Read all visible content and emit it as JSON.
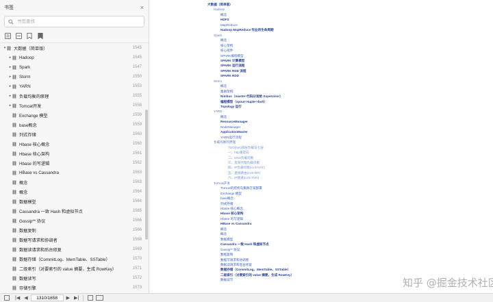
{
  "sidebar": {
    "title": "书签",
    "close_icon": "×",
    "search_placeholder": "书签查找",
    "tools": [
      "expand-all-icon",
      "collapse-all-icon",
      "add-bookmark-icon",
      "bookmark-options-icon"
    ],
    "items": [
      {
        "label": "大数据（简单版）",
        "page": "1545",
        "indent": 0,
        "arrow": "▾"
      },
      {
        "label": "Hadoop",
        "page": "1545",
        "indent": 1,
        "arrow": "▸"
      },
      {
        "label": "Spark",
        "page": "1547",
        "indent": 1,
        "arrow": "▸"
      },
      {
        "label": "Storm",
        "page": "1550",
        "indent": 1,
        "arrow": "▸"
      },
      {
        "label": "YARN",
        "page": "1553",
        "indent": 1,
        "arrow": "▸"
      },
      {
        "label": "负载均衡的原理",
        "page": "1555",
        "indent": 1,
        "arrow": "▸"
      },
      {
        "label": "Tomcat开发",
        "page": "1558",
        "indent": 1,
        "arrow": "▸"
      },
      {
        "label": "Exchange 模型",
        "page": "1559",
        "indent": 1,
        "arrow": ""
      },
      {
        "label": "base概念",
        "page": "1559",
        "indent": 1,
        "arrow": ""
      },
      {
        "label": "列式存储",
        "page": "1560",
        "indent": 1,
        "arrow": ""
      },
      {
        "label": "Hbase 核心概念",
        "page": "1560",
        "indent": 1,
        "arrow": ""
      },
      {
        "label": "Hbase 核心架构",
        "page": "1561",
        "indent": 1,
        "arrow": ""
      },
      {
        "label": "Hbase 的写逻辑",
        "page": "1562",
        "indent": 1,
        "arrow": ""
      },
      {
        "label": "HBase vs Cassandra",
        "page": "1563",
        "indent": 1,
        "arrow": ""
      },
      {
        "label": "概念",
        "page": "1563",
        "indent": 1,
        "arrow": ""
      },
      {
        "label": "概念",
        "page": "1564",
        "indent": 1,
        "arrow": ""
      },
      {
        "label": "数据模型",
        "page": "1564",
        "indent": 1,
        "arrow": ""
      },
      {
        "label": "Cassandra 一致 Hash 和虚拟节点",
        "page": "1565",
        "indent": 1,
        "arrow": ""
      },
      {
        "label": "Gossip** 协议",
        "page": "1566",
        "indent": 1,
        "arrow": ""
      },
      {
        "label": "数据复制",
        "page": "1566",
        "indent": 1,
        "arrow": ""
      },
      {
        "label": "数据写请求和协调者",
        "page": "1568",
        "indent": 1,
        "arrow": ""
      },
      {
        "label": "数据读请求和后台修复",
        "page": "1569",
        "indent": 1,
        "arrow": ""
      },
      {
        "label": "数据存储（CommitLog、MemTable、SSTable）",
        "page": "1570",
        "indent": 1,
        "arrow": ""
      },
      {
        "label": "二级索引（对要索引的 value 摘要，生成 RowKey）",
        "page": "1571",
        "indent": 1,
        "arrow": ""
      },
      {
        "label": "数据读写",
        "page": "1572",
        "indent": 1,
        "arrow": ""
      },
      {
        "label": "存储引擎",
        "page": "1573",
        "indent": 1,
        "arrow": ""
      }
    ]
  },
  "bottombar": {
    "current_page": "1310/1658",
    "first_icon": "|◀",
    "prev_icon": "◀",
    "next_icon": "▶",
    "last_icon": "▶|"
  },
  "doc": {
    "nodes": [
      {
        "text": "大数据（简单版）",
        "cls": "lvl0"
      },
      {
        "text": "Hadoop",
        "cls": "lvl1"
      },
      {
        "text": "概念",
        "cls": "lvl2"
      },
      {
        "text": "HDFS",
        "cls": "lvl2b"
      },
      {
        "text": "MapReduce",
        "cls": "lvl2"
      },
      {
        "text": "Hadoop MapReduce 作业的生命周期",
        "cls": "lvl2b"
      },
      {
        "text": "Spark",
        "cls": "lvl1"
      },
      {
        "text": "概念",
        "cls": "lvl2"
      },
      {
        "text": "核心架构",
        "cls": "lvl2"
      },
      {
        "text": "核心组件",
        "cls": "lvl2"
      },
      {
        "text": "SPARK编程模型",
        "cls": "lvl2"
      },
      {
        "text": "SPARK 计算模型",
        "cls": "lvl2b"
      },
      {
        "text": "SPARK 运行流程",
        "cls": "lvl2b"
      },
      {
        "text": "SPARK RDD 流程",
        "cls": "lvl2b"
      },
      {
        "text": "SPARK RDD",
        "cls": "lvl2b"
      },
      {
        "text": "Storm",
        "cls": "lvl1"
      },
      {
        "text": "概念",
        "cls": "lvl2"
      },
      {
        "text": "集群架构",
        "cls": "lvl2"
      },
      {
        "text": "Nimbus（master-代码分发给 Supervisor）",
        "cls": "lvl2b"
      },
      {
        "text": "编程模型（spout->tuple->bolt）",
        "cls": "lvl2b"
      },
      {
        "text": "Topology 运行",
        "cls": "lvl2b"
      },
      {
        "text": "YARN",
        "cls": "lvl1"
      },
      {
        "text": "概念",
        "cls": "lvl2"
      },
      {
        "text": "ResourceManager",
        "cls": "lvl2b"
      },
      {
        "text": "NodeManager",
        "cls": "lvl2"
      },
      {
        "text": "ApplicationMaster",
        "cls": "lvl2b"
      },
      {
        "text": "YARN运行流程",
        "cls": "lvl2"
      },
      {
        "text": "负载均衡的原理",
        "cls": "lvl1"
      },
      {
        "text": "7OO(Nei)四层负载与七层",
        "cls": "lvl3"
      },
      {
        "text": "一、http重定向",
        "cls": "lvl3"
      },
      {
        "text": "二、DNS负载均衡",
        "cls": "lvl3"
      },
      {
        "text": "三、反向代理负载均衡",
        "cls": "lvl3"
      },
      {
        "text": "四、IP负载均衡(LVS-NAT)",
        "cls": "lvl3"
      },
      {
        "text": "五、直接路由(LVS-DR)",
        "cls": "lvl3"
      },
      {
        "text": "六、IP隧道(LVS-TUN)",
        "cls": "lvl3"
      },
      {
        "text": "Tomcat开发",
        "cls": "lvl1"
      },
      {
        "text": "Tomcat的结构与集群方案部署",
        "cls": "lvl2"
      },
      {
        "text": "Exchange 模型",
        "cls": "lvl2"
      },
      {
        "text": "base概念",
        "cls": "lvl2"
      },
      {
        "text": "列式存储",
        "cls": "lvl2"
      },
      {
        "text": "Hbase 核心概念",
        "cls": "lvl2"
      },
      {
        "text": "Hbase 核心架构",
        "cls": "lvl2b"
      },
      {
        "text": "Hbase 的写逻辑",
        "cls": "lvl2"
      },
      {
        "text": "HBase vs Cassandra",
        "cls": "lvl2b"
      },
      {
        "text": "概念",
        "cls": "lvl2"
      },
      {
        "text": "概念",
        "cls": "lvl2"
      },
      {
        "text": "数据模型",
        "cls": "lvl2"
      },
      {
        "text": "Cassandra 一致 Hash 和虚拟节点",
        "cls": "lvl2b"
      },
      {
        "text": "Gossip** 协议",
        "cls": "lvl2"
      },
      {
        "text": "数据复制",
        "cls": "lvl2"
      },
      {
        "text": "数据写请求和协调者",
        "cls": "lvl2"
      },
      {
        "text": "数据读请求和后台修复",
        "cls": "lvl2"
      },
      {
        "text": "数据存储（CommitLog、MemTable、SSTable）",
        "cls": "lvl2b"
      },
      {
        "text": "二级索引（对要索引的 value 摘要，生成 RowKey）",
        "cls": "lvl2b"
      },
      {
        "text": "数据读写",
        "cls": "lvl2"
      }
    ]
  },
  "watermark": "知乎 @掘金技术社区",
  "colors": {
    "accent": "#2f55c8",
    "sidebar_bg": "#f7f7f8"
  }
}
